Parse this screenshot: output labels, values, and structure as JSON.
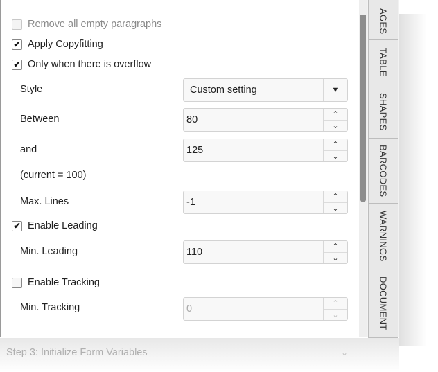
{
  "options": {
    "remove_empty_paragraphs": {
      "label": "Remove all empty paragraphs",
      "checked": false
    },
    "apply_copyfitting": {
      "label": "Apply Copyfitting",
      "checked": true
    },
    "only_when_overflow": {
      "label": "Only when there is overflow",
      "checked": true
    },
    "enable_leading": {
      "label": "Enable Leading",
      "checked": true
    },
    "enable_tracking": {
      "label": "Enable Tracking",
      "checked": false
    }
  },
  "fields": {
    "style": {
      "label": "Style",
      "value": "Custom setting"
    },
    "between": {
      "label": "Between",
      "value": "80"
    },
    "and": {
      "label": "and",
      "value": "125"
    },
    "current": {
      "label": "(current = 100)"
    },
    "max_lines": {
      "label": "Max. Lines",
      "value": "-1"
    },
    "min_leading": {
      "label": "Min. Leading",
      "value": "110"
    },
    "min_tracking": {
      "label": "Min. Tracking",
      "value": "0"
    }
  },
  "icons": {
    "check": "✔",
    "up": "⌃",
    "down": "⌄",
    "caret_down": "▼",
    "chevron_down": "⌄"
  },
  "side_tabs": [
    "AGES",
    "TABLE",
    "SHAPES",
    "BARCODES",
    "WARNINGS",
    "DOCUMENT"
  ],
  "step": {
    "label": "Step 3: Initialize Form Variables"
  }
}
